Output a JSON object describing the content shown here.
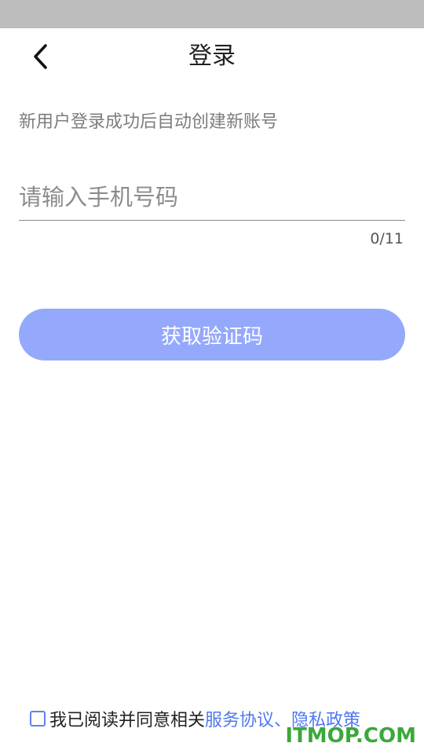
{
  "header": {
    "title": "登录",
    "back_icon": "chevron-left-icon"
  },
  "hint": "新用户登录成功后自动创建新账号",
  "phone": {
    "placeholder": "请输入手机号码",
    "value": "",
    "counter": "0/11"
  },
  "get_code_label": "获取验证码",
  "agreement": {
    "prefix": "我已阅读并同意相关",
    "service_link": "服务协议",
    "separator": "、",
    "privacy_link": "隐私政策",
    "checked": false
  },
  "watermark": "ITMOP.COM",
  "colors": {
    "button": "#94a9fc",
    "link": "#4f78f0",
    "status_bar": "#bdbdbd",
    "watermark": "#3aa83a"
  }
}
